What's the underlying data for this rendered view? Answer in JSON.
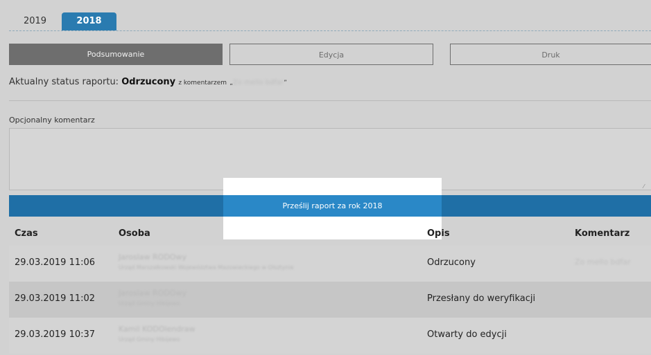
{
  "tabs": [
    {
      "label": "2019",
      "active": false
    },
    {
      "label": "2018",
      "active": true
    }
  ],
  "modes": {
    "summary": "Podsumowanie",
    "edit": "Edycja",
    "print": "Druk"
  },
  "status": {
    "prefix": "Aktualny status raportu:",
    "value": "Odrzucony",
    "comment_prefix": "z komentarzem",
    "comment_open": "„",
    "comment": "Zo mello bdfar",
    "comment_close": "”"
  },
  "comment_field": {
    "label": "Opcjonalny komentarz",
    "value": ""
  },
  "submit": {
    "label": "Prześlij raport za rok 2018"
  },
  "table": {
    "headers": [
      "Czas",
      "Osoba",
      "Opis",
      "Komentarz"
    ],
    "rows": [
      {
        "time": "29.03.2019 11:06",
        "person": "Jaroslaw RODOwy",
        "org": "Urząd Marszałkowski Województwa Mazowieckiego w Olsztynie",
        "desc": "Odrzucony",
        "comment": "Zo mello bdfar"
      },
      {
        "time": "29.03.2019 11:02",
        "person": "Jaroslaw RODOwy",
        "org": "Urząd Gminy Hlbijewo",
        "desc": "Przesłany do weryfikacji",
        "comment": ""
      },
      {
        "time": "29.03.2019 10:37",
        "person": "Kamil KODOlendraw",
        "org": "Urząd Gminy Hlbijewo",
        "desc": "Otwarty do edycji",
        "comment": ""
      }
    ]
  },
  "colors": {
    "accent": "#2a7bb0",
    "submit": "#1f6fa6",
    "background": "#d2d2d2"
  }
}
